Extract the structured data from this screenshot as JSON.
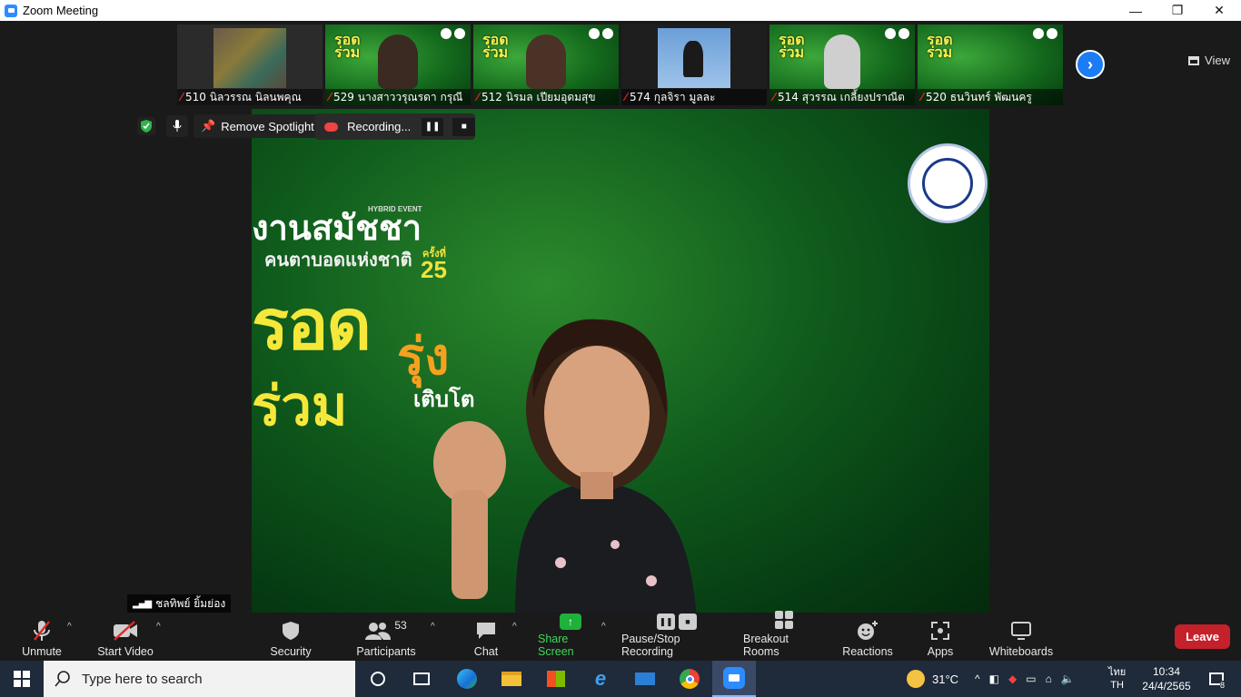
{
  "window": {
    "title": "Zoom Meeting",
    "minimize_glyph": "—",
    "restore_glyph": "❐",
    "close_glyph": "✕"
  },
  "gallery": {
    "view_label": "View",
    "tiles": [
      {
        "label": "510 นิลวรรณ นิลนพคุณ",
        "kind": "photo"
      },
      {
        "label": "529 นางสาววรุณรดา กรุณี",
        "kind": "green"
      },
      {
        "label": "512  นิรมล  เปียมอุดมสุข",
        "kind": "green"
      },
      {
        "label": "574 กุลจิรา มูลละ",
        "kind": "sky"
      },
      {
        "label": "514 สุวรรณ เกลี้ยงปราณีต",
        "kind": "green"
      },
      {
        "label": "520 ธนวินทร์ พัฒนครู",
        "kind": "green"
      }
    ]
  },
  "spotlight": {
    "remove_label": "Remove Spotlight",
    "recording_label": "Recording..."
  },
  "main_video": {
    "thai_line1": "งานสมัชชา",
    "thai_line2": "คนตาบอดแห่งชาติ",
    "edition_prefix": "ครั้งที่",
    "edition_number": "25",
    "hybrid": "HYBRID EVENT",
    "big1": "รอด",
    "big2": "รุ่ง",
    "big3": "ร่วม",
    "big4": "เติบโต"
  },
  "speaker_name": "ชลทิพย์ ยิ้มย่อง",
  "toolbar": {
    "unmute": "Unmute",
    "start_video": "Start Video",
    "security": "Security",
    "participants": "Participants",
    "participants_count": "53",
    "chat": "Chat",
    "share_screen": "Share Screen",
    "pause_stop_recording": "Pause/Stop Recording",
    "breakout_rooms": "Breakout Rooms",
    "reactions": "Reactions",
    "apps": "Apps",
    "whiteboards": "Whiteboards",
    "leave": "Leave"
  },
  "taskbar": {
    "search_placeholder": "Type here to search",
    "weather": "31°C",
    "language": "ไทย",
    "language_sub": "TH",
    "time": "10:34",
    "date": "24/4/2565",
    "notifications": "8"
  },
  "colors": {
    "accent_blue": "#1c7cf5",
    "leave_red": "#c4212b",
    "share_green": "#1fb13a",
    "muted_red": "#e02828"
  }
}
